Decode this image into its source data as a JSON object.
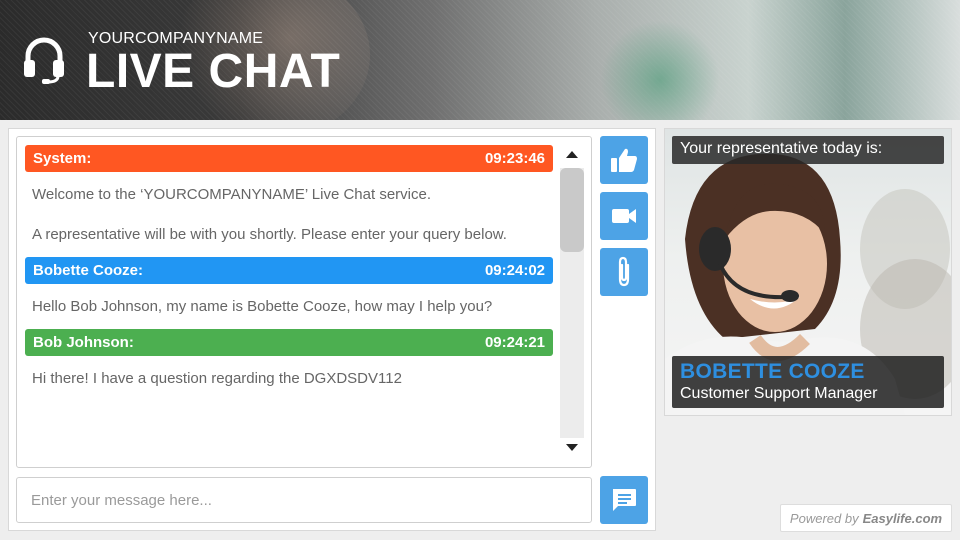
{
  "header": {
    "company": "YOURCOMPANYNAME",
    "title": "LIVE CHAT",
    "icon": "headset-icon"
  },
  "messages": [
    {
      "sender": "System:",
      "time": "09:23:46",
      "color": "#ff5722",
      "lines": [
        "Welcome to the ‘YOURCOMPANYNAME’ Live Chat service.",
        "A representative will be with you shortly. Please enter your query below."
      ]
    },
    {
      "sender": "Bobette Cooze:",
      "time": "09:24:02",
      "color": "#2196f3",
      "lines": [
        "Hello Bob Johnson, my name is Bobette Cooze, how may I help you?"
      ]
    },
    {
      "sender": "Bob Johnson:",
      "time": "09:24:21",
      "color": "#4caf50",
      "lines": [
        "Hi there! I have a question regarding the DGXDSDV112"
      ]
    }
  ],
  "side_buttons": [
    {
      "name": "like-button",
      "icon": "thumbs-up-icon"
    },
    {
      "name": "video-button",
      "icon": "video-camera-icon"
    },
    {
      "name": "attach-button",
      "icon": "paperclip-icon"
    }
  ],
  "composer": {
    "placeholder": "Enter your message here...",
    "send_icon": "message-bubble-icon"
  },
  "representative": {
    "label": "Your representative today is:",
    "name": "BOBETTE COOZE",
    "role": "Customer Support Manager"
  },
  "powered_by": {
    "prefix": "Powered by",
    "brand": "Easylife.com"
  },
  "colors": {
    "accent": "#4da3e6",
    "rep_name": "#2e8fe0"
  }
}
